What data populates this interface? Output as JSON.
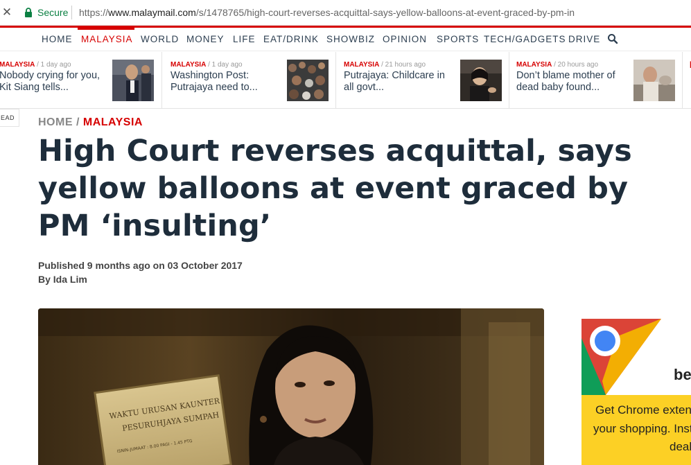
{
  "browser": {
    "secure_label": "Secure",
    "url_scheme": "https://",
    "url_host": "www.malaymail.com",
    "url_path": "/s/1478765/high-court-reverses-acquittal-says-yellow-balloons-at-event-graced-by-pm-in"
  },
  "nav": {
    "items": [
      "HOME",
      "MALAYSIA",
      "WORLD",
      "MONEY",
      "LIFE",
      "EAT/DRINK",
      "SHOWBIZ",
      "OPINION",
      "SPORTS",
      "TECH/GADGETS",
      "DRIVE"
    ],
    "active": "MALAYSIA"
  },
  "trending": [
    {
      "section": "MALAYSIA",
      "time": "/ 1 day ago",
      "headline": "Nobody crying for you, Kit Siang tells..."
    },
    {
      "section": "MALAYSIA",
      "time": "/ 1 day ago",
      "headline": "Washington Post: Putrajaya need to..."
    },
    {
      "section": "MALAYSIA",
      "time": "/ 21 hours ago",
      "headline": "Putrajaya: Childcare in all govt..."
    },
    {
      "section": "MALAYSIA",
      "time": "/ 20 hours ago",
      "headline": "Don’t blame mother of dead baby found..."
    }
  ],
  "lead_tag": "EAD",
  "article": {
    "breadcrumb_home": "HOME",
    "breadcrumb_sep": "/",
    "breadcrumb_section": "MALAYSIA",
    "title": "High Court reverses acquittal, says yellow balloons at event graced by PM ‘insulting’",
    "published": "Published 9 months ago on 03 October 2017",
    "author": "By Ida Lim",
    "hero_sign_line1": "WAKTU URUSAN KAUNTER",
    "hero_sign_line2": "PESURUHJAYA SUMPAH",
    "hero_sign_line3": "ISNIN-JUMAAT : 8.00 PAGI - 1.45 PTG"
  },
  "ad": {
    "partial_word": "be",
    "line1": "Get Chrome extens",
    "line2": "your shopping. Insta",
    "line3": "deal"
  },
  "colors": {
    "brand_red": "#d60000",
    "title_navy": "#1e2d3b",
    "ad_yellow": "#fcd025",
    "secure_green": "#0b8043"
  }
}
